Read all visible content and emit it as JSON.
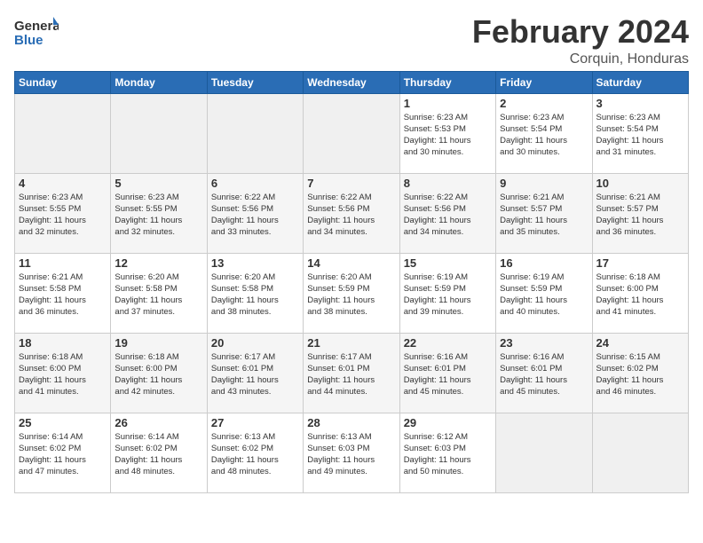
{
  "header": {
    "logo_general": "General",
    "logo_blue": "Blue",
    "month_title": "February 2024",
    "location": "Corquin, Honduras"
  },
  "days_of_week": [
    "Sunday",
    "Monday",
    "Tuesday",
    "Wednesday",
    "Thursday",
    "Friday",
    "Saturday"
  ],
  "weeks": [
    [
      {
        "day": "",
        "info": ""
      },
      {
        "day": "",
        "info": ""
      },
      {
        "day": "",
        "info": ""
      },
      {
        "day": "",
        "info": ""
      },
      {
        "day": "1",
        "info": "Sunrise: 6:23 AM\nSunset: 5:53 PM\nDaylight: 11 hours\nand 30 minutes."
      },
      {
        "day": "2",
        "info": "Sunrise: 6:23 AM\nSunset: 5:54 PM\nDaylight: 11 hours\nand 30 minutes."
      },
      {
        "day": "3",
        "info": "Sunrise: 6:23 AM\nSunset: 5:54 PM\nDaylight: 11 hours\nand 31 minutes."
      }
    ],
    [
      {
        "day": "4",
        "info": "Sunrise: 6:23 AM\nSunset: 5:55 PM\nDaylight: 11 hours\nand 32 minutes."
      },
      {
        "day": "5",
        "info": "Sunrise: 6:23 AM\nSunset: 5:55 PM\nDaylight: 11 hours\nand 32 minutes."
      },
      {
        "day": "6",
        "info": "Sunrise: 6:22 AM\nSunset: 5:56 PM\nDaylight: 11 hours\nand 33 minutes."
      },
      {
        "day": "7",
        "info": "Sunrise: 6:22 AM\nSunset: 5:56 PM\nDaylight: 11 hours\nand 34 minutes."
      },
      {
        "day": "8",
        "info": "Sunrise: 6:22 AM\nSunset: 5:56 PM\nDaylight: 11 hours\nand 34 minutes."
      },
      {
        "day": "9",
        "info": "Sunrise: 6:21 AM\nSunset: 5:57 PM\nDaylight: 11 hours\nand 35 minutes."
      },
      {
        "day": "10",
        "info": "Sunrise: 6:21 AM\nSunset: 5:57 PM\nDaylight: 11 hours\nand 36 minutes."
      }
    ],
    [
      {
        "day": "11",
        "info": "Sunrise: 6:21 AM\nSunset: 5:58 PM\nDaylight: 11 hours\nand 36 minutes."
      },
      {
        "day": "12",
        "info": "Sunrise: 6:20 AM\nSunset: 5:58 PM\nDaylight: 11 hours\nand 37 minutes."
      },
      {
        "day": "13",
        "info": "Sunrise: 6:20 AM\nSunset: 5:58 PM\nDaylight: 11 hours\nand 38 minutes."
      },
      {
        "day": "14",
        "info": "Sunrise: 6:20 AM\nSunset: 5:59 PM\nDaylight: 11 hours\nand 38 minutes."
      },
      {
        "day": "15",
        "info": "Sunrise: 6:19 AM\nSunset: 5:59 PM\nDaylight: 11 hours\nand 39 minutes."
      },
      {
        "day": "16",
        "info": "Sunrise: 6:19 AM\nSunset: 5:59 PM\nDaylight: 11 hours\nand 40 minutes."
      },
      {
        "day": "17",
        "info": "Sunrise: 6:18 AM\nSunset: 6:00 PM\nDaylight: 11 hours\nand 41 minutes."
      }
    ],
    [
      {
        "day": "18",
        "info": "Sunrise: 6:18 AM\nSunset: 6:00 PM\nDaylight: 11 hours\nand 41 minutes."
      },
      {
        "day": "19",
        "info": "Sunrise: 6:18 AM\nSunset: 6:00 PM\nDaylight: 11 hours\nand 42 minutes."
      },
      {
        "day": "20",
        "info": "Sunrise: 6:17 AM\nSunset: 6:01 PM\nDaylight: 11 hours\nand 43 minutes."
      },
      {
        "day": "21",
        "info": "Sunrise: 6:17 AM\nSunset: 6:01 PM\nDaylight: 11 hours\nand 44 minutes."
      },
      {
        "day": "22",
        "info": "Sunrise: 6:16 AM\nSunset: 6:01 PM\nDaylight: 11 hours\nand 45 minutes."
      },
      {
        "day": "23",
        "info": "Sunrise: 6:16 AM\nSunset: 6:01 PM\nDaylight: 11 hours\nand 45 minutes."
      },
      {
        "day": "24",
        "info": "Sunrise: 6:15 AM\nSunset: 6:02 PM\nDaylight: 11 hours\nand 46 minutes."
      }
    ],
    [
      {
        "day": "25",
        "info": "Sunrise: 6:14 AM\nSunset: 6:02 PM\nDaylight: 11 hours\nand 47 minutes."
      },
      {
        "day": "26",
        "info": "Sunrise: 6:14 AM\nSunset: 6:02 PM\nDaylight: 11 hours\nand 48 minutes."
      },
      {
        "day": "27",
        "info": "Sunrise: 6:13 AM\nSunset: 6:02 PM\nDaylight: 11 hours\nand 48 minutes."
      },
      {
        "day": "28",
        "info": "Sunrise: 6:13 AM\nSunset: 6:03 PM\nDaylight: 11 hours\nand 49 minutes."
      },
      {
        "day": "29",
        "info": "Sunrise: 6:12 AM\nSunset: 6:03 PM\nDaylight: 11 hours\nand 50 minutes."
      },
      {
        "day": "",
        "info": ""
      },
      {
        "day": "",
        "info": ""
      }
    ]
  ]
}
